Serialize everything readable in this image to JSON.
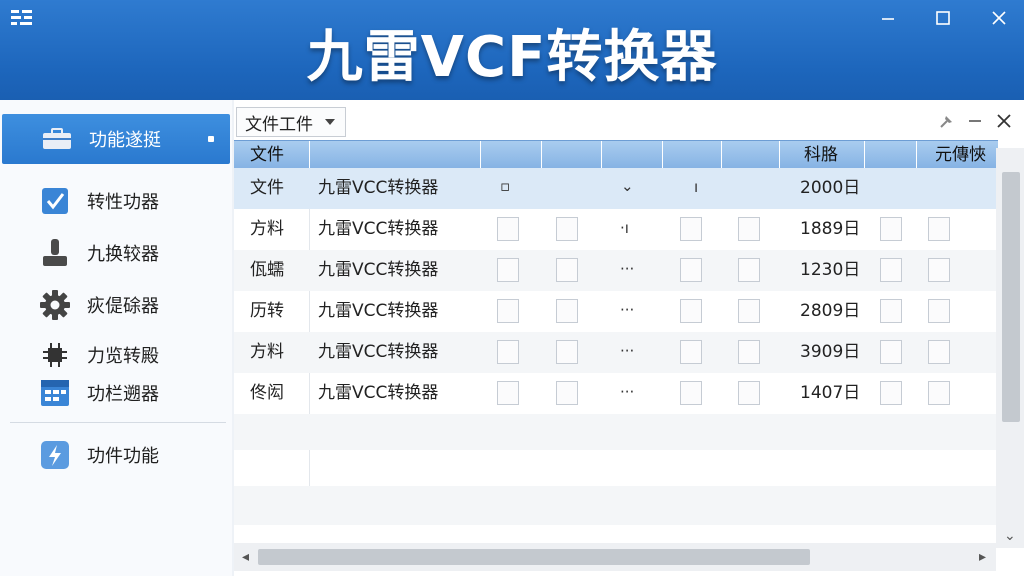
{
  "window": {
    "title": "九雷VCF转换器",
    "app_icon": "app-icon",
    "controls": [
      "minimize-icon",
      "maximize-icon",
      "close-icon"
    ]
  },
  "sidebar": {
    "items": [
      {
        "label": "功能遂挺",
        "icon": "toolbox-icon",
        "active": true
      },
      {
        "label": "转性功器",
        "icon": "checkbox-icon"
      },
      {
        "label": "九换较器",
        "icon": "joystick-icon"
      },
      {
        "label": "疢偍硢器",
        "icon": "gear-icon"
      },
      {
        "label": "力览转殿",
        "icon": "chip-icon"
      },
      {
        "label": "功栏遡器",
        "icon": "grid-icon"
      },
      {
        "label": "功件功能",
        "icon": "lightning-icon"
      }
    ]
  },
  "toolbar": {
    "file_menu_label": "文件工件",
    "icons": [
      "pin-icon",
      "minimize-icon",
      "close-icon"
    ]
  },
  "table": {
    "headers": {
      "col1": "文件",
      "date": "科胳",
      "last": "元傳悏"
    },
    "rows": [
      {
        "col1": "文件",
        "name": "九雷VCC转换器",
        "value": "2000日"
      },
      {
        "col1": "方料",
        "name": "九雷VCC转换器",
        "value": "1889日"
      },
      {
        "col1": "佤蠕",
        "name": "九雷VCC转换器",
        "value": "1230日"
      },
      {
        "col1": "历转",
        "name": "九雷VCC转换器",
        "value": "2809日"
      },
      {
        "col1": "方料",
        "name": "九雷VCC转换器",
        "value": "3909日"
      },
      {
        "col1": "佟闳",
        "name": "九雷VCC转换器",
        "value": "1407日"
      }
    ]
  },
  "colors": {
    "titlebar": "#1d66bc",
    "active_item": "#2a79cf",
    "header": "#86b3e4",
    "selected_row": "#dbe9f7"
  }
}
